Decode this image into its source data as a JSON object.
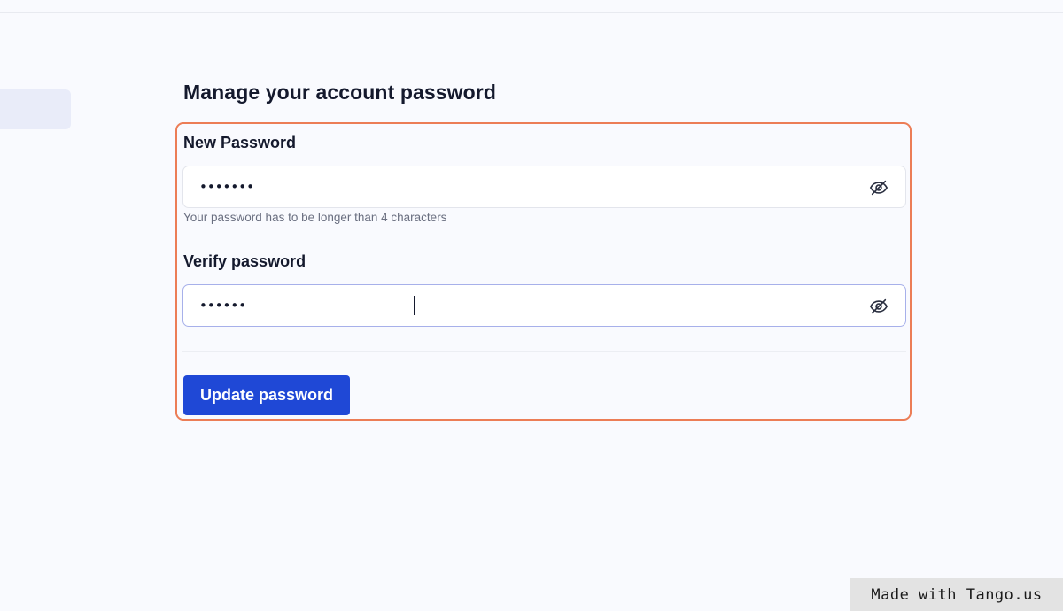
{
  "page": {
    "title": "Manage your account password"
  },
  "form": {
    "new_password": {
      "label": "New Password",
      "value": "•••••••",
      "helper": "Your password has to be longer than 4 characters",
      "toggle_icon": "eye-off-icon"
    },
    "verify_password": {
      "label": "Verify password",
      "value": "••••••",
      "toggle_icon": "eye-off-icon"
    },
    "submit_label": "Update password"
  },
  "watermark": {
    "text": "Made with Tango.us"
  },
  "colors": {
    "accent": "#1f48d6",
    "highlight": "#ec7d56",
    "background": "#f9fafe"
  }
}
